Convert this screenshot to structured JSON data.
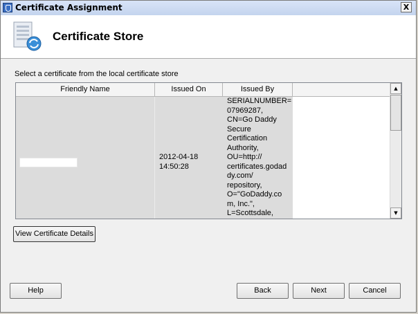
{
  "window": {
    "title": "Certificate Assignment",
    "close_label": "X"
  },
  "header": {
    "title": "Certificate Store"
  },
  "instruction": "Select a certificate from the local certificate store",
  "grid": {
    "columns": [
      "Friendly Name",
      "Issued On",
      "Issued By",
      ""
    ],
    "rows": [
      {
        "friendly_name": "",
        "issued_on": "2012-04-18\n14:50:28",
        "issued_by": "SERIALNUMBER=\n07969287,\nCN=Go Daddy\nSecure\nCertification\nAuthority,\nOU=http://\ncertificates.godad\ndy.com/\nrepository,\nO=\"GoDaddy.co\nm, Inc.\",\nL=Scottsdale,"
      }
    ]
  },
  "buttons": {
    "view_details": "View Certificate Details",
    "help": "Help",
    "back": "Back",
    "next": "Next",
    "cancel": "Cancel"
  },
  "icons": {
    "app": "certificate-app-icon",
    "store": "certificate-store-icon",
    "close": "close-icon"
  }
}
